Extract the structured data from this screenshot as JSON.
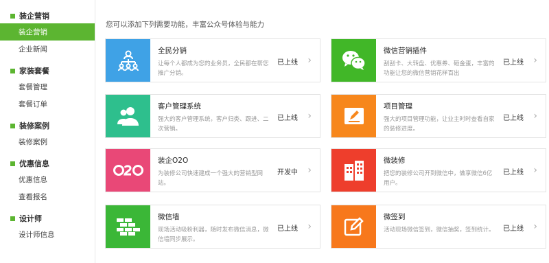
{
  "sidebar": {
    "groups": [
      {
        "title": "装企营销",
        "items": [
          "装企营销",
          "企业新闻"
        ]
      },
      {
        "title": "家装套餐",
        "items": [
          "套餐管理",
          "套餐订单"
        ]
      },
      {
        "title": "装修案例",
        "items": [
          "装修案例"
        ]
      },
      {
        "title": "优惠信息",
        "items": [
          "优惠信息",
          "查看报名"
        ]
      },
      {
        "title": "设计师",
        "items": [
          "设计师信息"
        ]
      }
    ]
  },
  "main": {
    "intro": "您可以添加下列需要功能，丰富公众号体验与能力",
    "cards": [
      {
        "title": "全民分销",
        "desc": "让每个人都成为您的业务员，全民都在帮您推广分销。",
        "status": "已上线",
        "color": "#3fa2e6",
        "icon": "org-chart-icon"
      },
      {
        "title": "微信营销插件",
        "desc": "刮刮卡、大转盘、优惠券、砸金蛋，丰富的功能让您的微信营销花样百出",
        "status": "已上线",
        "color": "#41b728",
        "icon": "wechat-icon"
      },
      {
        "title": "客户管理系统",
        "desc": "强大的客户管理系统，客户归类、跟进、二次营销。",
        "status": "已上线",
        "color": "#2ebf8d",
        "icon": "users-icon"
      },
      {
        "title": "项目管理",
        "desc": "强大的项目管理功能，让业主时时查看自家的装修进度。",
        "status": "已上线",
        "color": "#f7871c",
        "icon": "edit-board-icon"
      },
      {
        "title": "装企O2O",
        "desc": "为装修公司快速建成一个强大的营销型网站。",
        "status": "开发中",
        "color": "#e94877",
        "icon": "o2o-icon"
      },
      {
        "title": "微装修",
        "desc": "把您的装修公司开到微信中，做享微信6亿用户。",
        "status": "已上线",
        "color": "#ee3e2c",
        "icon": "buildings-icon"
      },
      {
        "title": "微信墙",
        "desc": "现场活动吸粉利器，随时发布微信消息，微信墙同步展示。",
        "status": "已上线",
        "color": "#3bb737",
        "icon": "brick-wall-icon"
      },
      {
        "title": "微签到",
        "desc": "活动现场微信签到，微信抽奖，签到统计。",
        "status": "已上线",
        "color": "#f7781c",
        "icon": "sign-in-edit-icon"
      }
    ]
  }
}
